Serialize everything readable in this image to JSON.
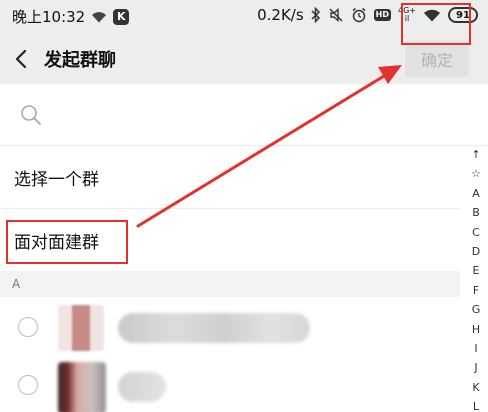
{
  "status_bar": {
    "time": "晚上10:32",
    "speed": "0.2K/s",
    "network_top": "4G+",
    "network_bottom": "il",
    "hd": "HD",
    "k_badge": "K",
    "battery": "91",
    "icons": [
      "wifi-icon",
      "k-app-icon",
      "bluetooth-icon",
      "mute-icon",
      "alarm-icon",
      "hd-icon",
      "signal-icon",
      "wifi-icon",
      "battery-icon"
    ]
  },
  "header": {
    "back_icon": "chevron-left-icon",
    "title": "发起群聊",
    "confirm_label": "确定",
    "confirm_color": "#b4b4b4"
  },
  "search": {
    "icon": "search-icon",
    "placeholder": ""
  },
  "menu": {
    "items": [
      {
        "label": "选择一个群"
      },
      {
        "label": "面对面建群"
      }
    ]
  },
  "section": {
    "letter": "A"
  },
  "index_bar": {
    "letters": [
      "↑",
      "☆",
      "A",
      "B",
      "C",
      "D",
      "E",
      "F",
      "G",
      "H",
      "I",
      "J",
      "K",
      "L"
    ]
  },
  "annotations": {
    "highlight_color": "#e3312d"
  }
}
